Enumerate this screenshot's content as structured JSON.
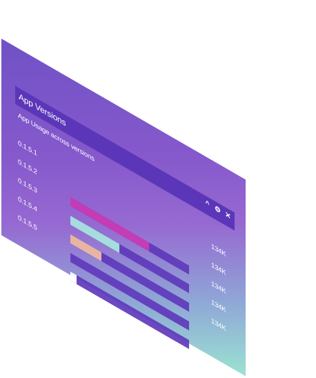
{
  "window": {
    "title": "App Versions",
    "controls": [
      "^",
      "⚙",
      "✕"
    ]
  },
  "chart": {
    "subtitle": "App Usage across versions"
  },
  "rows": [
    {
      "version": "0.1.5.1",
      "usage": "134K",
      "fill_fraction": 0.66,
      "color": "#c839b4"
    },
    {
      "version": "0.1.5.2",
      "usage": "134K",
      "fill_fraction": 0.41,
      "color": "#a8e6e0"
    },
    {
      "version": "0.1.5.3",
      "usage": "134K",
      "fill_fraction": 0.26,
      "color": "#f0b9a0"
    },
    {
      "version": "0.1.5.4",
      "usage": "134K",
      "fill_fraction": 0.0,
      "color": "#7a57d0"
    },
    {
      "version": "0.1.5.5",
      "usage": "134K",
      "fill_fraction": 0.05,
      "color": "#ffffff"
    }
  ],
  "colors": {
    "titlebar": "#5b36b8",
    "track": "#5f39bb",
    "panel_gradient_start": "#6f52c6",
    "panel_gradient_end": "#9be3d2"
  }
}
